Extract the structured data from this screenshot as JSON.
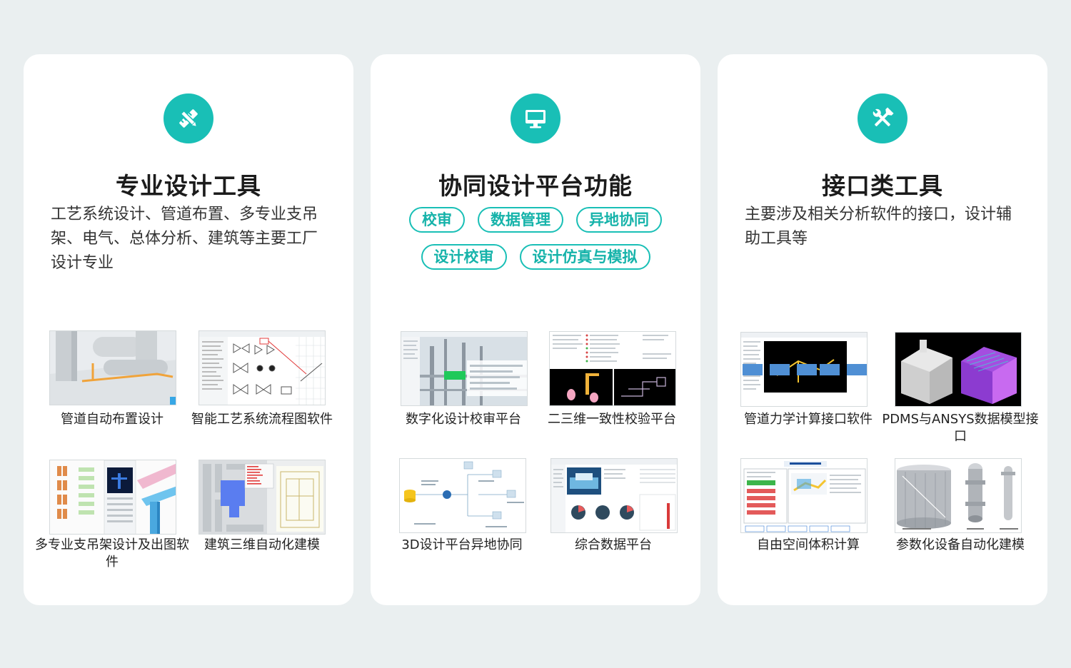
{
  "colors": {
    "accent": "#19bfb6",
    "page_bg": "#eaeff0",
    "card_bg": "#ffffff"
  },
  "cards": [
    {
      "icon": "ruler-pencil-icon",
      "title": "专业设计工具",
      "desc": "工艺系统设计、管道布置、多专业支吊架、电气、总体分析、建筑等主要工厂设计专业",
      "items": [
        {
          "label": "管道自动布置设计"
        },
        {
          "label": "智能工艺系统流程图软件"
        },
        {
          "label": "多专业支吊架设计及出图软件"
        },
        {
          "label": "建筑三维自动化建模"
        }
      ]
    },
    {
      "icon": "monitor-icon",
      "title": "协同设计平台功能",
      "tags": [
        "校审",
        "数据管理",
        "异地协同",
        "设计校审",
        "设计仿真与模拟"
      ],
      "items": [
        {
          "label": "数字化设计校审平台"
        },
        {
          "label": "二三维一致性校验平台"
        },
        {
          "label": "3D设计平台异地协同"
        },
        {
          "label": "综合数据平台"
        }
      ]
    },
    {
      "icon": "tools-icon",
      "title": "接口类工具",
      "desc": "主要涉及相关分析软件的接口，设计辅助工具等",
      "items": [
        {
          "label": "管道力学计算接口软件"
        },
        {
          "label": "PDMS与ANSYS数据模型接口"
        },
        {
          "label": "自由空间体积计算"
        },
        {
          "label": "参数化设备自动化建模"
        }
      ]
    }
  ]
}
